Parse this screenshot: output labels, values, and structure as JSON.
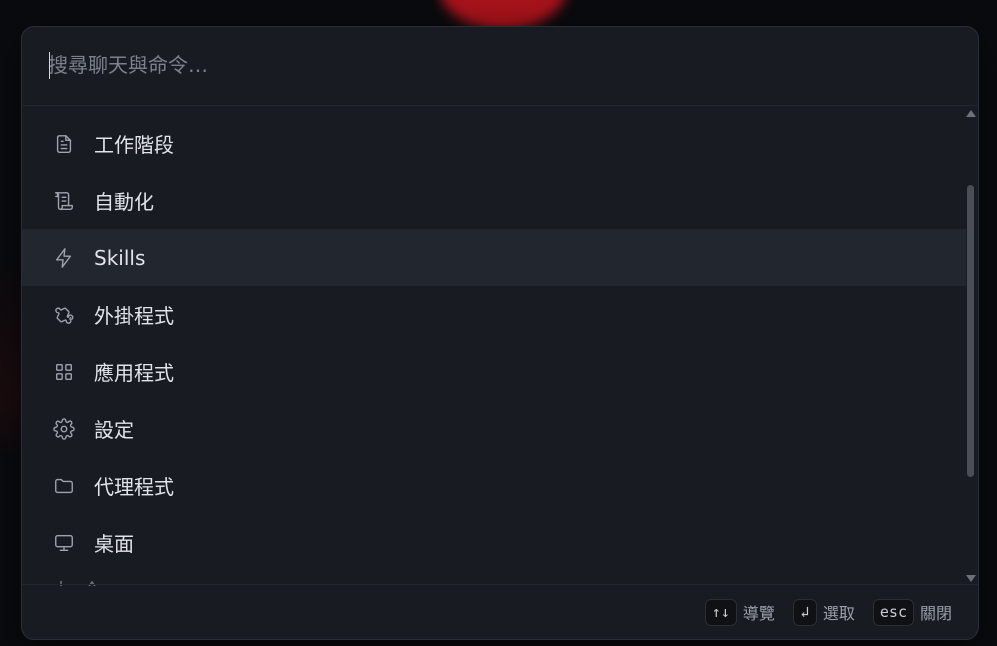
{
  "search": {
    "placeholder": "搜尋聊天與命令…",
    "value": ""
  },
  "menu": {
    "items": [
      {
        "label": "工作階段",
        "icon": "file-text-icon"
      },
      {
        "label": "自動化",
        "icon": "scroll-icon"
      },
      {
        "label": "Skills",
        "icon": "lightning-icon",
        "active": true
      },
      {
        "label": "外掛程式",
        "icon": "puzzle-icon"
      },
      {
        "label": "應用程式",
        "icon": "grid-icon"
      },
      {
        "label": "設定",
        "icon": "gear-icon"
      },
      {
        "label": "代理程式",
        "icon": "folder-icon"
      },
      {
        "label": "桌面",
        "icon": "monitor-icon"
      }
    ]
  },
  "footer": {
    "navigate_key": "↑↓",
    "navigate_label": "導覽",
    "select_key": "↲",
    "select_label": "選取",
    "close_key": "esc",
    "close_label": "關閉"
  },
  "colors": {
    "panel_bg": "#181b22",
    "active_row": "#22262f",
    "accent_blob": "#c2151c"
  }
}
